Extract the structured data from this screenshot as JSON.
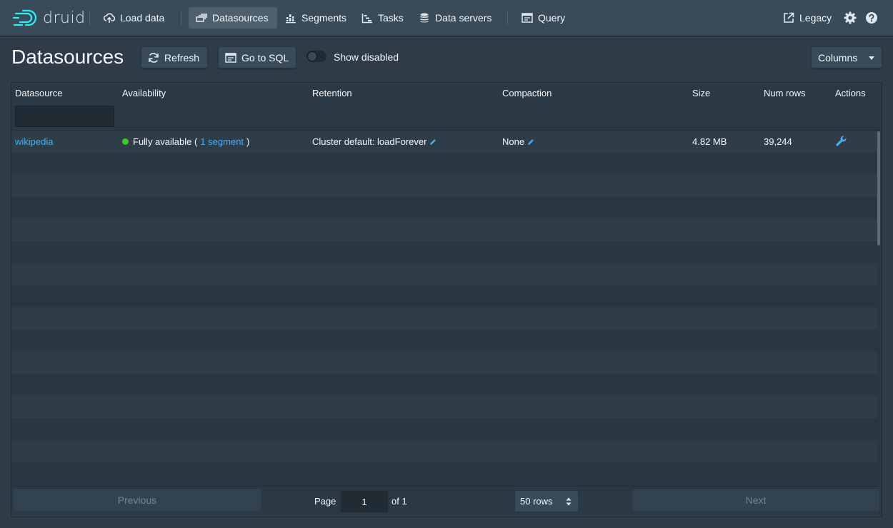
{
  "nav": {
    "brand": "druid",
    "load_data": "Load data",
    "datasources": "Datasources",
    "segments": "Segments",
    "tasks": "Tasks",
    "data_servers": "Data servers",
    "query": "Query",
    "legacy": "Legacy",
    "icons": [
      "cloud-upload-icon",
      "multi-select-icon",
      "stacked-chart-icon",
      "gantt-chart-icon",
      "database-icon",
      "application-icon",
      "share-icon",
      "cog-icon",
      "help-icon"
    ]
  },
  "header": {
    "title": "Datasources",
    "refresh": "Refresh",
    "go_to_sql": "Go to SQL",
    "show_disabled": "Show disabled",
    "columns": "Columns"
  },
  "table": {
    "columns": [
      "Datasource",
      "Availability",
      "Retention",
      "Compaction",
      "Size",
      "Num rows",
      "Actions"
    ],
    "rows": [
      {
        "datasource": "wikipedia",
        "availability_prefix": "Fully available (",
        "availability_link": "1 segment",
        "availability_suffix": ")",
        "retention": "Cluster default: loadForever",
        "compaction": "None",
        "size": "4.82 MB",
        "num_rows": "39,244"
      }
    ]
  },
  "pagination": {
    "previous": "Previous",
    "page_label": "Page",
    "page": "1",
    "of": "of 1",
    "rows": "50 rows",
    "next": "Next"
  },
  "colors": {
    "link": "#48aff0",
    "status_green": "#3dcc1f",
    "navbar": "#394b59",
    "background": "#2f3b47"
  }
}
